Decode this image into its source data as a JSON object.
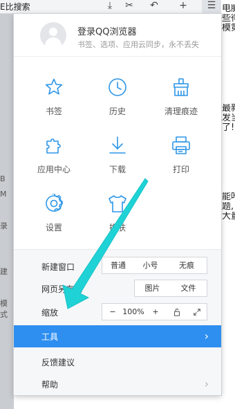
{
  "background": {
    "toolbar_text": "E比搜索",
    "left_glyphs": [
      "B",
      "M",
      "录",
      "",
      "建",
      "",
      "",
      "模式"
    ],
    "right_snippets": [
      "电脑",
      "些得",
      "模第",
      "最新",
      "发当",
      "了!",
      "能叶",
      "题,",
      "大量"
    ]
  },
  "account": {
    "title": "登录QQ浏览器",
    "subtitle": "书签、选项、应用云同步，永不丢失"
  },
  "grid": [
    {
      "label": "书签",
      "icon": "star-icon"
    },
    {
      "label": "历史",
      "icon": "clock-icon"
    },
    {
      "label": "清理痕迹",
      "icon": "broom-icon"
    },
    {
      "label": "应用中心",
      "icon": "puzzle-icon"
    },
    {
      "label": "下载",
      "icon": "download-icon"
    },
    {
      "label": "打印",
      "icon": "printer-icon"
    },
    {
      "label": "设置",
      "icon": "gear-icon"
    },
    {
      "label": "换肤",
      "icon": "shirt-icon"
    }
  ],
  "rows": {
    "new_window": {
      "label": "新建窗口",
      "options": [
        "普通",
        "小号",
        "无痕"
      ]
    },
    "save_as": {
      "label": "网页另存为",
      "options": [
        "图片",
        "文件"
      ]
    },
    "zoom": {
      "label": "缩放",
      "minus": "−",
      "value": "100%",
      "plus": "+"
    },
    "tools": {
      "label": "工具",
      "arrow": "›"
    },
    "feedback": {
      "label": "反馈建议"
    },
    "help": {
      "label": "帮助",
      "arrow": "›"
    }
  },
  "colors": {
    "accent": "#2f8ff0",
    "icon_blue": "#2c96e8",
    "arrow_teal": "#1fd2d6"
  }
}
